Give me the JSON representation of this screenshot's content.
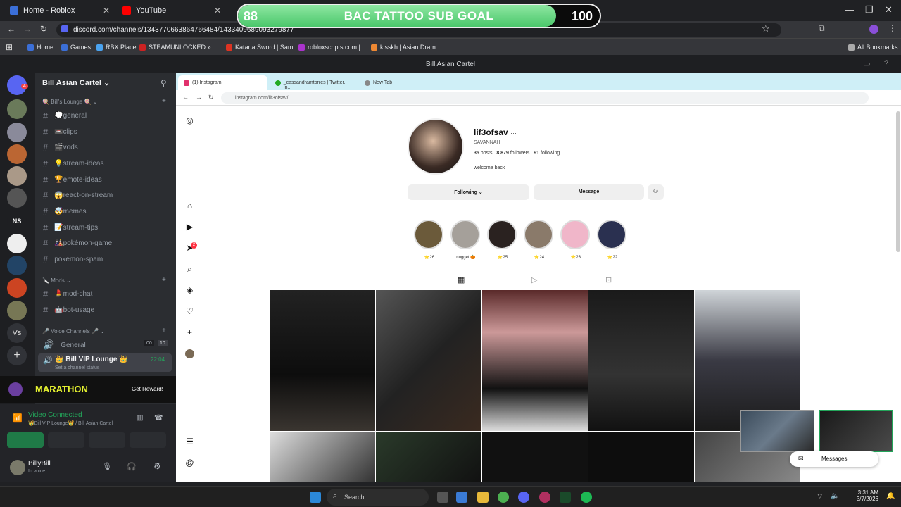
{
  "browser": {
    "tabs": [
      {
        "label": "Home - Roblox"
      },
      {
        "label": "YouTube"
      }
    ],
    "url": "discord.com/channels/1343770663864766484/1433409689093279877",
    "bookmarks": [
      "Home",
      "Games",
      "RBX.Place",
      "STEAMUNLOCKED »...",
      "Katana Sword | Sam...",
      "robloxscripts.com |...",
      "kisskh | Asian Dram..."
    ],
    "all_bookmarks": "All Bookmarks"
  },
  "goal": {
    "left": "88",
    "title": "BAC TATTOO SUB GOAL",
    "right": "100",
    "progress": 0.88
  },
  "discord": {
    "window_title": "Bill Asian Cartel",
    "server_name": "Bill Asian Cartel",
    "cat1": "Bill's Lounge",
    "channels1": [
      {
        "name": "💭general"
      },
      {
        "name": "📼clips"
      },
      {
        "name": "🎬vods"
      },
      {
        "name": "💡stream-ideas"
      },
      {
        "name": "🏆emote-ideas"
      },
      {
        "name": "😱react-on-stream"
      },
      {
        "name": "🤯memes"
      },
      {
        "name": "📝stream-tips"
      },
      {
        "name": "🎎pokémon-game"
      },
      {
        "name": "pokemon-spam"
      }
    ],
    "cat2": "Mods",
    "channels2": [
      {
        "name": "💄mod-chat"
      },
      {
        "name": "🤖bot-usage"
      }
    ],
    "cat3": "Voice Channels 🎤",
    "voice": [
      {
        "name": "General",
        "count_a": "00",
        "count_b": "10"
      },
      {
        "name": "👑 Bill VIP Lounge 👑",
        "time": "22:04",
        "status": "Set a channel status"
      }
    ],
    "promo": {
      "label": "MARATHON",
      "button": "Get Reward!"
    },
    "voice_status": {
      "title": "Video Connected",
      "sub": "👑Bill VIP Lounge👑 / Bill Asian Cartel"
    },
    "user": {
      "name": "BillyBill",
      "status": "In voice"
    },
    "server_badge": "4",
    "ns_label": "NS",
    "vs_label": "Vs"
  },
  "instagram": {
    "tabs": [
      "(1) Instagram",
      "_cassandramtorres | Twitter, In...",
      "New Tab"
    ],
    "url": "instagram.com/lif3ofsav/",
    "username": "lif3ofsav",
    "fullname": "SAVANNAH",
    "posts": "35",
    "posts_label": "posts",
    "followers": "8,879",
    "followers_label": "followers",
    "following": "91",
    "following_label": "following",
    "bio": "welcome back",
    "btn_following": "Following",
    "btn_message": "Message",
    "highlights": [
      "⭐26",
      "nugget 🎃",
      "⭐25",
      "⭐24",
      "⭐23",
      "⭐22"
    ],
    "notif_badge": "2",
    "messages_label": "Messages"
  },
  "taskbar": {
    "search": "Search",
    "time": "3:31 AM",
    "date": "3/7/2026"
  }
}
